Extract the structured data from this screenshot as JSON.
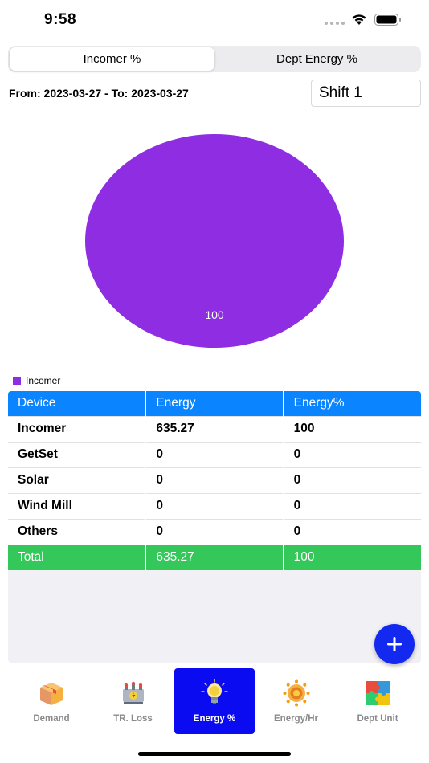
{
  "status": {
    "time": "9:58"
  },
  "segments": [
    {
      "label": "Incomer %",
      "active": true
    },
    {
      "label": "Dept Energy %",
      "active": false
    }
  ],
  "date_range": "From: 2023-03-27 - To: 2023-03-27",
  "shift": {
    "selected": "Shift 1"
  },
  "chart_data": {
    "type": "pie",
    "slices": [
      {
        "label": "Incomer",
        "value": 100,
        "color": "#8e2de2"
      }
    ],
    "data_labels": [
      "100"
    ],
    "legend": [
      "Incomer"
    ],
    "legend_placement": "bottom-left"
  },
  "table": {
    "headers": [
      "Device",
      "Energy",
      "Energy%"
    ],
    "rows": [
      [
        "Incomer",
        "635.27",
        "100"
      ],
      [
        "GetSet",
        "0",
        "0"
      ],
      [
        "Solar",
        "0",
        "0"
      ],
      [
        "Wind Mill",
        "0",
        "0"
      ],
      [
        "Others",
        "0",
        "0"
      ]
    ],
    "total": [
      "Total",
      "635.27",
      "100"
    ]
  },
  "fab": {
    "icon": "plus-icon"
  },
  "tabs": [
    {
      "label": "Demand",
      "icon": "box-icon",
      "active": false
    },
    {
      "label": "TR. Loss",
      "icon": "transformer-icon",
      "active": false
    },
    {
      "label": "Energy %",
      "icon": "lightbulb-icon",
      "active": true
    },
    {
      "label": "Energy/Hr",
      "icon": "sun-icon",
      "active": false
    },
    {
      "label": "Dept Unit",
      "icon": "puzzle-icon",
      "active": false
    }
  ],
  "colors": {
    "header": "#0a84ff",
    "total": "#34c759",
    "pie": "#8e2de2",
    "fab": "#1429f0",
    "active_tab": "#0b0bf2"
  }
}
